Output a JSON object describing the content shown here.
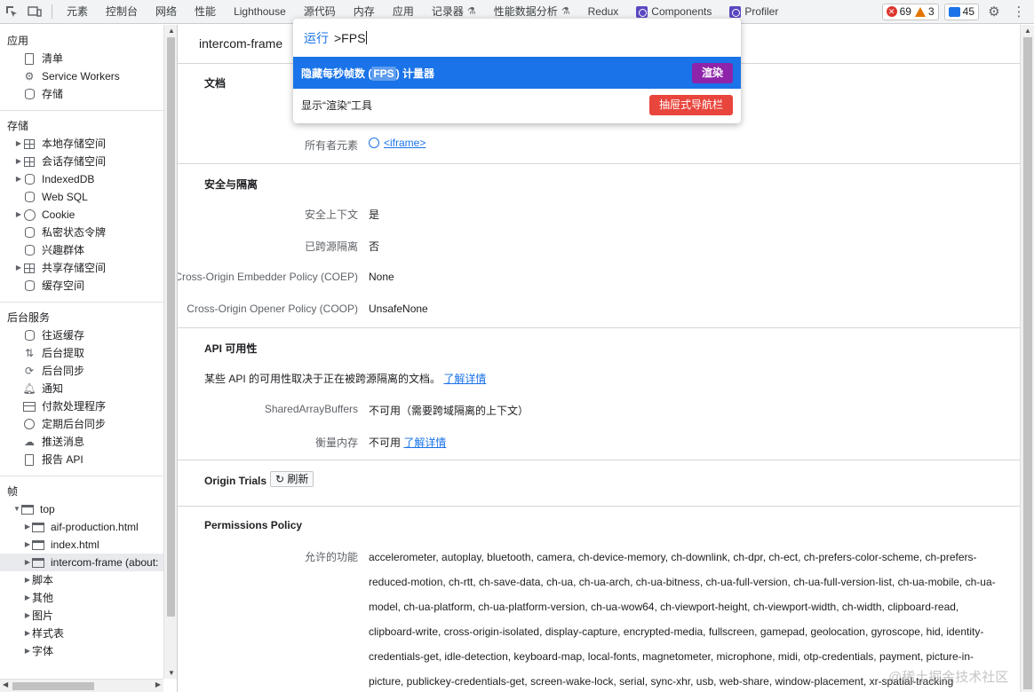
{
  "toolbar": {
    "tabs": [
      {
        "label": "元素"
      },
      {
        "label": "控制台"
      },
      {
        "label": "网络"
      },
      {
        "label": "性能"
      },
      {
        "label": "Lighthouse"
      },
      {
        "label": "源代码"
      },
      {
        "label": "内存"
      },
      {
        "label": "应用"
      },
      {
        "label": "记录器"
      },
      {
        "label": "性能数据分析"
      },
      {
        "label": "Redux"
      },
      {
        "label": "Components"
      },
      {
        "label": "Profiler"
      }
    ],
    "errors": "69",
    "warnings": "3",
    "messages": "45"
  },
  "sidebar": {
    "app_section": "应用",
    "app_items": [
      "清单",
      "Service Workers",
      "存储"
    ],
    "storage_section": "存储",
    "storage_items": [
      "本地存储空间",
      "会话存储空间",
      "IndexedDB",
      "Web SQL",
      "Cookie",
      "私密状态令牌",
      "兴趣群体",
      "共享存储空间",
      "缓存空间"
    ],
    "bg_section": "后台服务",
    "bg_items": [
      "往返缓存",
      "后台提取",
      "后台同步",
      "通知",
      "付款处理程序",
      "定期后台同步",
      "推送消息",
      "报告 API"
    ],
    "frames_section": "帧",
    "frames_items": [
      "top",
      "aif-production.html",
      "index.html",
      "intercom-frame (about:",
      "脚本",
      "其他",
      "图片",
      "样式表",
      "字体"
    ]
  },
  "main": {
    "frame_title": "intercom-frame",
    "doc_title": "文档",
    "owner_label": "所有者元素",
    "owner_value": "<iframe>",
    "security_title": "安全与隔离",
    "secure_context_label": "安全上下文",
    "secure_context_value": "是",
    "cross_origin_isolated_label": "已跨源隔离",
    "cross_origin_isolated_value": "否",
    "coep_label": "Cross-Origin Embedder Policy (COEP)",
    "coep_value": "None",
    "coop_label": "Cross-Origin Opener Policy (COOP)",
    "coop_value": "UnsafeNone",
    "api_title": "API 可用性",
    "api_desc": "某些 API 的可用性取决于正在被跨源隔离的文档。",
    "learn_more": "了解详情",
    "sab_label": "SharedArrayBuffers",
    "sab_value": "不可用（需要跨域隔离的上下文）",
    "measure_label": "衡量内存",
    "measure_value": "不可用",
    "origin_trials_title": "Origin Trials",
    "refresh": "刷新",
    "permissions_title": "Permissions Policy",
    "allowed_label": "允许的功能",
    "allowed_value": "accelerometer, autoplay, bluetooth, camera, ch-device-memory, ch-downlink, ch-dpr, ch-ect, ch-prefers-color-scheme, ch-prefers-reduced-motion, ch-rtt, ch-save-data, ch-ua, ch-ua-arch, ch-ua-bitness, ch-ua-full-version, ch-ua-full-version-list, ch-ua-mobile, ch-ua-model, ch-ua-platform, ch-ua-platform-version, ch-ua-wow64, ch-viewport-height, ch-viewport-width, ch-width, clipboard-read, clipboard-write, cross-origin-isolated, display-capture, encrypted-media, fullscreen, gamepad, geolocation, gyroscope, hid, identity-credentials-get, idle-detection, keyboard-map, local-fonts, magnetometer, microphone, midi, otp-credentials, payment, picture-in-picture, publickey-credentials-get, screen-wake-lock, serial, sync-xhr, usb, web-share, window-placement, xr-spatial-tracking"
  },
  "command_menu": {
    "prefix": "运行",
    "query": ">FPS",
    "items": [
      {
        "label_before": "隐藏每秒帧数 (",
        "label_match": "FPS",
        "label_after": ") 计量器",
        "badge": "渲染",
        "badge_color": "#8e24aa"
      },
      {
        "label": "显示“渲染”工具",
        "badge": "抽屉式导航栏",
        "badge_color": "#e8453c"
      }
    ]
  },
  "watermark": "@稀土掘金技术社区",
  "colors": {
    "accent": "#1a73e8",
    "error": "#dc362e",
    "warning": "#e37400"
  }
}
